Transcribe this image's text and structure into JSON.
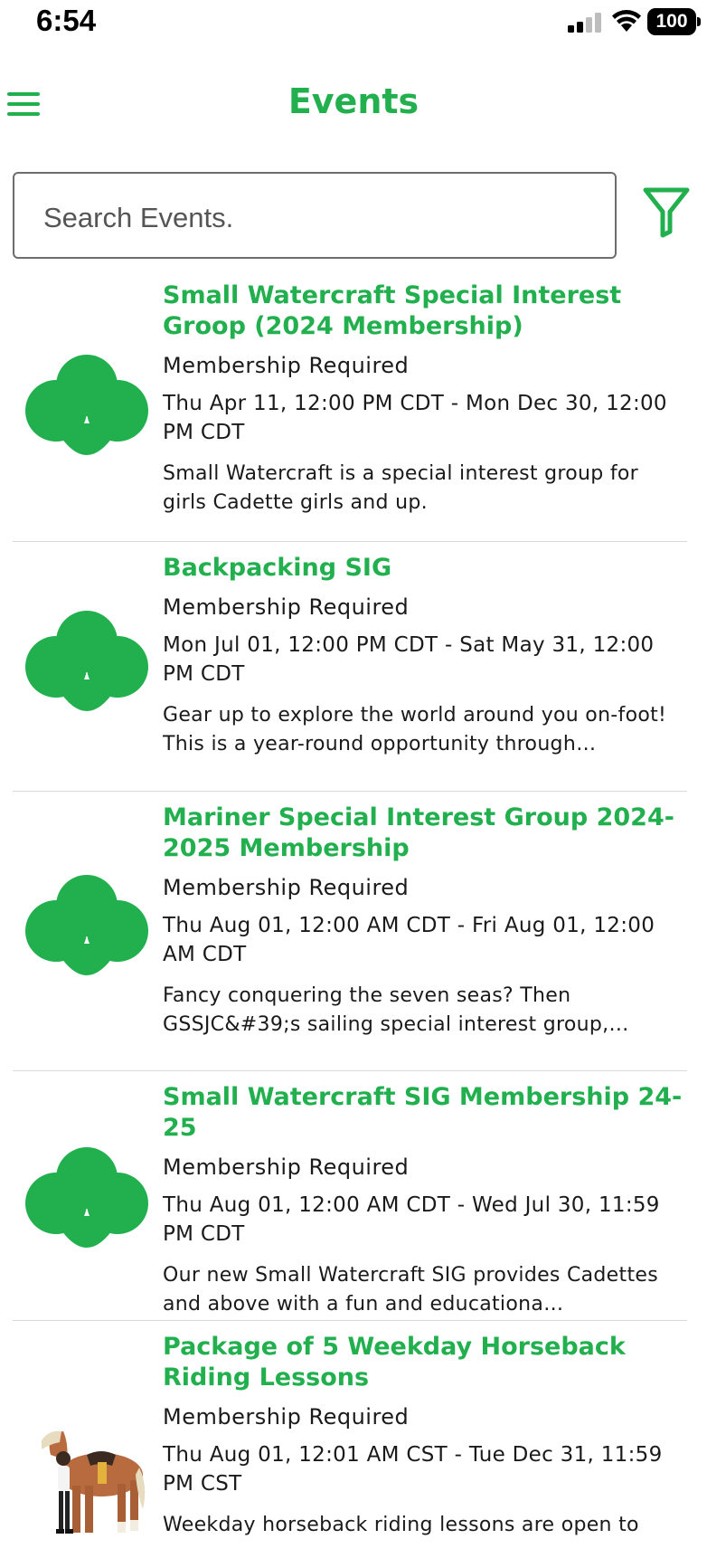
{
  "status_bar": {
    "time": "6:54",
    "battery": "100"
  },
  "header": {
    "title": "Events"
  },
  "search": {
    "placeholder": "Search Events."
  },
  "events": [
    {
      "title": "Small Watercraft Special Interest Groop (2024 Membership)",
      "requirement": "Membership Required",
      "dates": "Thu Apr 11, 12:00 PM CDT - Mon Dec 30, 12:00 PM CDT",
      "description": "Small Watercraft is a special interest group for girls Cadette girls and up.",
      "image": "trefoil-icon"
    },
    {
      "title": "Backpacking SIG",
      "requirement": "Membership Required",
      "dates": "Mon Jul 01, 12:00 PM CDT - Sat May 31, 12:00 PM CDT",
      "description": "Gear up to explore the world around you on-foot! This is a year-round opportunity through…",
      "image": "trefoil-icon"
    },
    {
      "title": "Mariner Special Interest Group 2024-2025 Membership",
      "requirement": "Membership Required",
      "dates": "Thu Aug 01, 12:00 AM CDT - Fri Aug 01, 12:00 AM CDT",
      "description": "Fancy conquering the seven seas? Then GSSJC&#39;s sailing special interest group,…",
      "image": "trefoil-icon"
    },
    {
      "title": "Small Watercraft SIG Membership 24-25",
      "requirement": "Membership Required",
      "dates": "Thu Aug 01, 12:00 AM CDT - Wed Jul 30, 11:59 PM CDT",
      "description": "Our new Small Watercraft SIG provides Cadettes and above with a fun and educationa…",
      "image": "trefoil-icon"
    },
    {
      "title": "Package of 5 Weekday Horseback Riding Lessons",
      "requirement": "Membership Required",
      "dates": "Thu Aug 01, 12:01 AM CST - Tue Dec 31, 11:59 PM CST",
      "description": "Weekday horseback riding lessons are open to",
      "image": "horse-rider-illustration"
    }
  ],
  "colors": {
    "accent": "#22b04f",
    "divider": "#d9d9d9",
    "text": "#1a1a1a"
  }
}
